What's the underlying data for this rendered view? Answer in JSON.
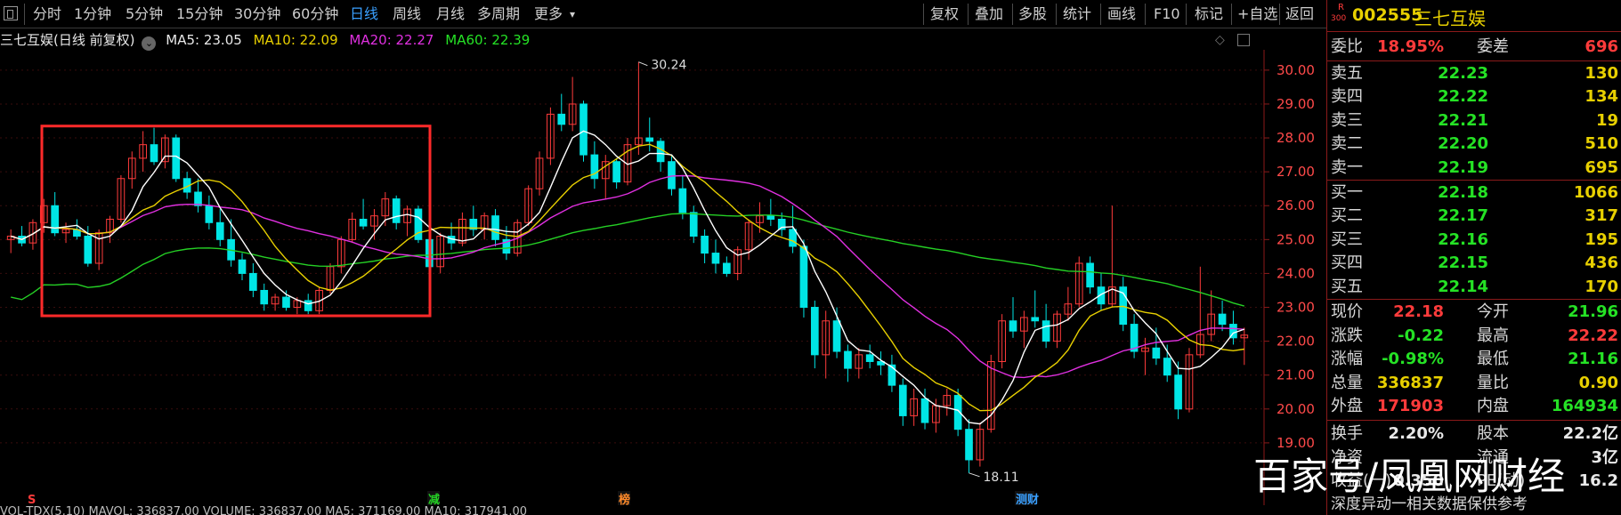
{
  "toolbar": {
    "periods": [
      "分时",
      "1分钟",
      "5分钟",
      "15分钟",
      "30分钟",
      "60分钟",
      "日线",
      "周线",
      "月线",
      "多周期",
      "更多"
    ],
    "active_period": "日线",
    "more_arrow": "▾",
    "tools": [
      "复权",
      "叠加",
      "多股",
      "统计",
      "画线",
      "F10",
      "标记",
      "+自选",
      "返回"
    ]
  },
  "info": {
    "stock_title": "三七互娱(日线 前复权)",
    "ma5": "MA5: 23.05",
    "ma10": "MA10: 22.09",
    "ma20": "MA20: 22.27",
    "ma60": "MA60: 22.39"
  },
  "colors": {
    "up": "#ff3b3b",
    "down": "#00e5e5",
    "ma5": "#ffffff",
    "ma10": "#e8d000",
    "ma20": "#e030e0",
    "ma60": "#25d025",
    "highlight_box": "#ff2a2a",
    "axis": "#8b1a1a"
  },
  "chart_data": {
    "type": "candlestick",
    "ylim": [
      18.0,
      30.6
    ],
    "y_ticks": [
      "30.00",
      "29.00",
      "28.00",
      "27.00",
      "26.00",
      "25.00",
      "24.00",
      "23.00",
      "22.00",
      "21.00",
      "20.00",
      "19.00"
    ],
    "high_label": "30.24",
    "low_label": "18.11",
    "candles": [
      [
        25.0,
        25.3,
        24.6,
        25.1
      ],
      [
        25.1,
        25.4,
        24.8,
        24.9
      ],
      [
        24.9,
        25.6,
        24.7,
        25.5
      ],
      [
        25.5,
        26.2,
        25.2,
        26.0
      ],
      [
        26.0,
        26.4,
        25.1,
        25.2
      ],
      [
        25.2,
        25.5,
        24.9,
        25.3
      ],
      [
        25.3,
        25.6,
        25.0,
        25.1
      ],
      [
        25.1,
        25.4,
        24.2,
        24.3
      ],
      [
        24.3,
        25.3,
        24.1,
        25.2
      ],
      [
        25.2,
        25.7,
        24.9,
        25.6
      ],
      [
        25.6,
        26.9,
        25.5,
        26.8
      ],
      [
        26.8,
        27.6,
        26.5,
        27.4
      ],
      [
        27.4,
        28.2,
        27.0,
        27.8
      ],
      [
        27.8,
        28.3,
        27.2,
        27.3
      ],
      [
        27.3,
        28.1,
        27.1,
        28.0
      ],
      [
        28.0,
        28.1,
        26.7,
        26.8
      ],
      [
        26.8,
        27.0,
        26.2,
        26.4
      ],
      [
        26.4,
        26.8,
        25.8,
        26.0
      ],
      [
        26.0,
        26.3,
        25.3,
        25.5
      ],
      [
        25.5,
        25.9,
        24.8,
        25.0
      ],
      [
        25.0,
        25.6,
        24.2,
        24.4
      ],
      [
        24.4,
        24.6,
        23.8,
        24.0
      ],
      [
        24.0,
        24.3,
        23.3,
        23.5
      ],
      [
        23.5,
        23.7,
        22.9,
        23.1
      ],
      [
        23.1,
        23.4,
        22.9,
        23.3
      ],
      [
        23.3,
        23.5,
        22.9,
        23.0
      ],
      [
        23.0,
        23.3,
        22.8,
        23.2
      ],
      [
        23.2,
        23.4,
        22.8,
        22.9
      ],
      [
        22.9,
        23.6,
        22.8,
        23.5
      ],
      [
        23.5,
        24.3,
        23.4,
        24.2
      ],
      [
        24.2,
        25.1,
        24.0,
        25.0
      ],
      [
        25.0,
        25.8,
        24.9,
        25.6
      ],
      [
        25.6,
        26.2,
        25.3,
        25.4
      ],
      [
        25.4,
        25.9,
        25.0,
        25.7
      ],
      [
        25.7,
        26.4,
        25.4,
        26.2
      ],
      [
        26.2,
        26.3,
        25.3,
        25.5
      ],
      [
        25.5,
        26.0,
        25.1,
        25.9
      ],
      [
        25.9,
        26.0,
        24.9,
        25.0
      ],
      [
        25.0,
        25.3,
        24.1,
        24.2
      ],
      [
        24.2,
        25.2,
        24.0,
        25.1
      ],
      [
        25.1,
        25.5,
        24.7,
        24.9
      ],
      [
        24.9,
        25.8,
        24.8,
        25.6
      ],
      [
        25.6,
        26.0,
        25.1,
        25.3
      ],
      [
        25.3,
        25.8,
        25.0,
        25.7
      ],
      [
        25.7,
        25.9,
        24.8,
        25.0
      ],
      [
        25.0,
        25.4,
        24.4,
        24.6
      ],
      [
        24.6,
        25.6,
        24.5,
        25.5
      ],
      [
        25.5,
        26.6,
        25.4,
        26.5
      ],
      [
        26.5,
        27.6,
        26.3,
        27.4
      ],
      [
        27.4,
        28.9,
        27.2,
        28.7
      ],
      [
        28.7,
        29.3,
        28.2,
        28.4
      ],
      [
        28.4,
        29.8,
        28.2,
        29.0
      ],
      [
        29.0,
        29.1,
        27.3,
        27.5
      ],
      [
        27.5,
        27.9,
        26.5,
        26.8
      ],
      [
        26.8,
        27.5,
        26.2,
        27.3
      ],
      [
        27.3,
        27.4,
        26.5,
        26.7
      ],
      [
        26.7,
        28.0,
        26.6,
        27.8
      ],
      [
        27.8,
        30.24,
        27.5,
        28.0
      ],
      [
        28.0,
        28.6,
        27.6,
        27.9
      ],
      [
        27.9,
        28.0,
        27.0,
        27.3
      ],
      [
        27.3,
        27.5,
        26.3,
        26.5
      ],
      [
        26.5,
        26.9,
        25.6,
        25.8
      ],
      [
        25.8,
        26.0,
        24.9,
        25.1
      ],
      [
        25.1,
        25.3,
        24.3,
        24.6
      ],
      [
        24.6,
        25.0,
        24.0,
        24.3
      ],
      [
        24.3,
        24.5,
        23.9,
        24.0
      ],
      [
        24.0,
        24.8,
        23.8,
        24.7
      ],
      [
        24.7,
        25.6,
        24.4,
        25.5
      ],
      [
        25.5,
        26.1,
        25.2,
        25.7
      ],
      [
        25.7,
        26.2,
        25.4,
        25.6
      ],
      [
        25.6,
        25.8,
        25.1,
        25.3
      ],
      [
        25.3,
        26.0,
        24.6,
        24.8
      ],
      [
        24.8,
        25.0,
        22.7,
        23.0
      ],
      [
        23.0,
        23.2,
        21.2,
        21.6
      ],
      [
        21.6,
        22.9,
        20.9,
        22.6
      ],
      [
        22.6,
        23.0,
        21.5,
        21.7
      ],
      [
        21.7,
        21.9,
        20.8,
        21.2
      ],
      [
        21.2,
        21.8,
        20.9,
        21.6
      ],
      [
        21.6,
        21.9,
        21.2,
        21.4
      ],
      [
        21.4,
        21.7,
        21.0,
        21.3
      ],
      [
        21.3,
        21.6,
        20.5,
        20.7
      ],
      [
        20.7,
        20.9,
        19.5,
        19.8
      ],
      [
        19.8,
        20.6,
        19.5,
        20.3
      ],
      [
        20.3,
        20.6,
        19.4,
        19.6
      ],
      [
        19.6,
        20.3,
        19.3,
        20.1
      ],
      [
        20.1,
        20.6,
        19.8,
        20.4
      ],
      [
        20.4,
        20.6,
        19.2,
        19.4
      ],
      [
        19.4,
        19.7,
        18.11,
        18.5
      ],
      [
        18.5,
        19.6,
        18.3,
        19.4
      ],
      [
        19.4,
        21.6,
        19.3,
        21.4
      ],
      [
        21.4,
        22.8,
        21.2,
        22.6
      ],
      [
        22.6,
        23.3,
        22.1,
        22.3
      ],
      [
        22.3,
        22.9,
        21.8,
        22.7
      ],
      [
        22.7,
        23.5,
        22.4,
        22.6
      ],
      [
        22.6,
        23.1,
        21.8,
        22.0
      ],
      [
        22.0,
        22.9,
        21.8,
        22.8
      ],
      [
        22.8,
        23.6,
        22.6,
        23.1
      ],
      [
        23.1,
        24.5,
        23.0,
        24.3
      ],
      [
        24.3,
        24.5,
        23.4,
        23.6
      ],
      [
        23.6,
        24.0,
        22.9,
        23.1
      ],
      [
        23.1,
        26.0,
        23.0,
        23.6
      ],
      [
        23.6,
        23.9,
        22.3,
        22.5
      ],
      [
        22.5,
        22.8,
        21.5,
        21.7
      ],
      [
        21.7,
        22.1,
        21.0,
        21.8
      ],
      [
        21.8,
        22.4,
        21.3,
        21.5
      ],
      [
        21.5,
        21.9,
        20.8,
        21.0
      ],
      [
        21.0,
        21.4,
        19.7,
        20.0
      ],
      [
        20.0,
        21.8,
        19.9,
        21.6
      ],
      [
        21.6,
        24.2,
        21.5,
        22.2
      ],
      [
        22.2,
        23.5,
        22.0,
        22.8
      ],
      [
        22.8,
        23.2,
        22.3,
        22.5
      ],
      [
        22.5,
        22.9,
        21.9,
        22.1
      ],
      [
        22.1,
        22.4,
        21.3,
        22.18
      ]
    ],
    "annotations": [
      "减",
      "榜",
      "S",
      "测财"
    ]
  },
  "panel": {
    "badge_top": "R",
    "badge_bottom": "300",
    "code": "002555",
    "name": "三七互娱",
    "weibi": {
      "label": "委比",
      "value": "18.95%",
      "label2": "委差",
      "value2": "696"
    },
    "sells": [
      {
        "label": "卖五",
        "price": "22.23",
        "vol": "130"
      },
      {
        "label": "卖四",
        "price": "22.22",
        "vol": "134"
      },
      {
        "label": "卖三",
        "price": "22.21",
        "vol": "19"
      },
      {
        "label": "卖二",
        "price": "22.20",
        "vol": "510"
      },
      {
        "label": "卖一",
        "price": "22.19",
        "vol": "695"
      }
    ],
    "buys": [
      {
        "label": "买一",
        "price": "22.18",
        "vol": "1066"
      },
      {
        "label": "买二",
        "price": "22.17",
        "vol": "317"
      },
      {
        "label": "买三",
        "price": "22.16",
        "vol": "195"
      },
      {
        "label": "买四",
        "price": "22.15",
        "vol": "436"
      },
      {
        "label": "买五",
        "price": "22.14",
        "vol": "170"
      }
    ],
    "stats": [
      {
        "l1": "现价",
        "v1": "22.18",
        "c1": "red",
        "l2": "今开",
        "v2": "21.96",
        "c2": "green"
      },
      {
        "l1": "涨跌",
        "v1": "-0.22",
        "c1": "green",
        "l2": "最高",
        "v2": "22.22",
        "c2": "red"
      },
      {
        "l1": "涨幅",
        "v1": "-0.98%",
        "c1": "green",
        "l2": "最低",
        "v2": "21.16",
        "c2": "green"
      },
      {
        "l1": "总量",
        "v1": "336837",
        "c1": "yellow",
        "l2": "量比",
        "v2": "0.90",
        "c2": "yellow"
      },
      {
        "l1": "外盘",
        "v1": "171903",
        "c1": "red",
        "l2": "内盘",
        "v2": "164934",
        "c2": "green"
      },
      {
        "l1": "换手",
        "v1": "2.20%",
        "c1": "white",
        "l2": "股本",
        "v2": "22.2亿",
        "c2": "white"
      },
      {
        "l1": "净资",
        "v1": "",
        "c1": "white",
        "l2": "流通",
        "v2": "3亿",
        "c2": "white"
      },
      {
        "l1": "收益(一)",
        "v1": "0.350",
        "c1": "white",
        "l2": "PE(动)",
        "v2": "16.2",
        "c2": "white"
      }
    ],
    "footer": "深度异动一相关数据保供参考"
  },
  "watermark": "百家号/凤凰网财经",
  "bottom_info": "VOL-TDX(5,10) MAVOL: 336837.00   VOLUME: 336837.00  MA5: 371169.00   MA10: 317941.00"
}
